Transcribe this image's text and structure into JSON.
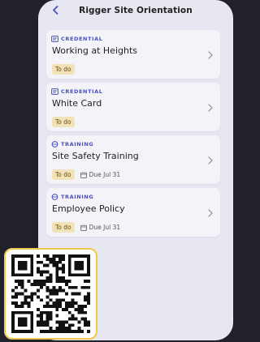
{
  "header": {
    "title": "Rigger Site Orientation",
    "back_icon": "chevron-left-icon"
  },
  "colors": {
    "accent": "#4a4fbd",
    "badge_bg": "#f2e2b8",
    "badge_text": "#6b4e11",
    "background": "#20212a",
    "panel": "#e6e7f0",
    "qr_border": "#f0c94a"
  },
  "tasks": [
    {
      "category": "CREDENTIAL",
      "category_icon": "id-card-icon",
      "name": "Working at Heights",
      "status": "To do"
    },
    {
      "category": "CREDENTIAL",
      "category_icon": "id-card-icon",
      "name": "White Card",
      "status": "To do"
    },
    {
      "category": "TRAINING",
      "category_icon": "training-cap-icon",
      "name": "Site Safety Training",
      "status": "To do",
      "due": "Due Jul 31"
    },
    {
      "category": "TRAINING",
      "category_icon": "training-cap-icon",
      "name": "Employee Policy",
      "status": "To do",
      "due": "Due Jul 31"
    }
  ],
  "qr": {
    "icon": "qr-code-icon"
  }
}
